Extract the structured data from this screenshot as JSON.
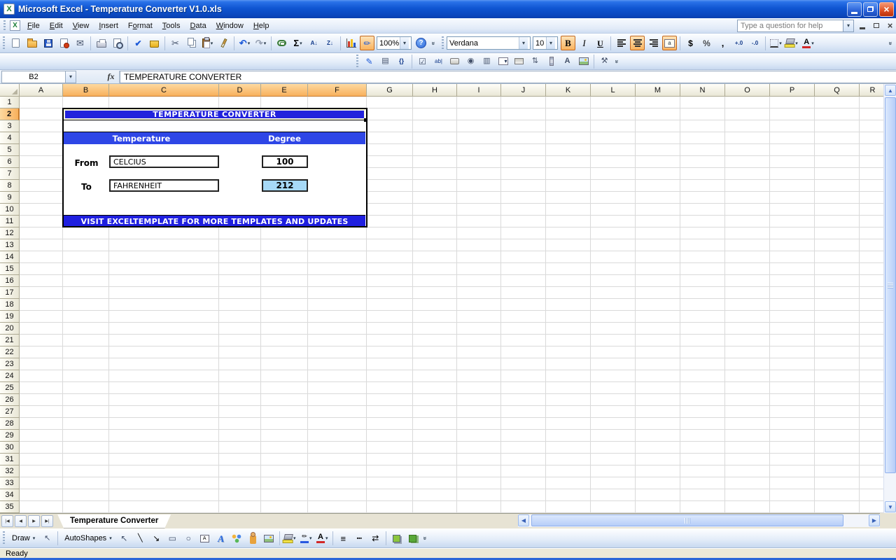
{
  "icons": {
    "dropdown": "▾",
    "excel_logo": "X",
    "fx": "fx",
    "close": "×",
    "chevron": "»",
    "scroll_up": "▲",
    "scroll_down": "▼",
    "scroll_left": "◀",
    "scroll_right": "▶"
  },
  "colors": {
    "xp_title_blue": "#0f55d2",
    "form_title_blue": "#2222dd",
    "form_band_blue": "#2e46e6",
    "form_footer_blue": "#1f1fe0",
    "result_cell_fill": "#a6d9f7",
    "selected_header_orange": "#f8b05c"
  },
  "window": {
    "title": "Microsoft Excel - Temperature Converter V1.0.xls"
  },
  "menu_bar": {
    "items": [
      {
        "label": "File",
        "accel": 0
      },
      {
        "label": "Edit",
        "accel": 0
      },
      {
        "label": "View",
        "accel": 0
      },
      {
        "label": "Insert",
        "accel": 0
      },
      {
        "label": "Format",
        "accel": 1
      },
      {
        "label": "Tools",
        "accel": 0
      },
      {
        "label": "Data",
        "accel": 0
      },
      {
        "label": "Window",
        "accel": 0
      },
      {
        "label": "Help",
        "accel": 0
      }
    ],
    "help_placeholder": "Type a question for help"
  },
  "standard_toolbar": {
    "zoom_value": "100%",
    "items": [
      {
        "name": "new",
        "cls": "i-page"
      },
      {
        "name": "open",
        "cls": "i-folder"
      },
      {
        "name": "save",
        "cls": "i-floppy"
      },
      {
        "name": "permission",
        "cls": "i-page i-perm"
      },
      {
        "name": "email",
        "glyph": "✉",
        "gcls": "c-slate fs13"
      },
      {
        "type": "sep"
      },
      {
        "name": "print",
        "cls": "i-printer"
      },
      {
        "name": "print-preview",
        "cls": "i-preview"
      },
      {
        "type": "sep"
      },
      {
        "name": "spelling",
        "glyph": "✔",
        "gcls": "c-blue fs12 bold"
      },
      {
        "name": "research",
        "cls": "i-book"
      },
      {
        "type": "sep"
      },
      {
        "name": "cut",
        "glyph": "✂",
        "gcls": "c-slate fs13"
      },
      {
        "name": "copy",
        "cls": "i-copy"
      },
      {
        "name": "paste",
        "cls": "i-paste",
        "dd": true
      },
      {
        "name": "format-painter",
        "cls": "i-brush"
      },
      {
        "type": "sep"
      },
      {
        "name": "undo",
        "glyph": "↶",
        "gcls": "c-blue fs13 bold",
        "dd": true
      },
      {
        "name": "redo",
        "glyph": "↷",
        "gcls": "c-gray fs13 bold",
        "dd": true
      },
      {
        "type": "sep"
      },
      {
        "name": "insert-hyperlink",
        "cls": "i-link"
      },
      {
        "name": "autosum",
        "glyph": "Σ",
        "gcls": "fs13 bold",
        "dd": true
      },
      {
        "name": "sort-ascending",
        "glyph": "A↓",
        "gcls": "fs8 bold c-navy"
      },
      {
        "name": "sort-descending",
        "glyph": "Z↓",
        "gcls": "fs8 bold c-navy"
      },
      {
        "type": "sep"
      },
      {
        "name": "chart-wizard",
        "cls": "i-chart"
      },
      {
        "name": "drawing",
        "glyph": "✏",
        "gcls": "c-blue fs12",
        "active": true
      }
    ]
  },
  "formatting_toolbar": {
    "font": "Verdana",
    "size": "10",
    "items": [
      {
        "name": "bold",
        "glyph": "B",
        "gcls": "serif bold fs13",
        "active": true
      },
      {
        "name": "italic",
        "glyph": "I",
        "gcls": "serif ital fs13"
      },
      {
        "name": "underline",
        "glyph": "U",
        "gcls": "serif bold underline fs12"
      },
      {
        "type": "sep"
      },
      {
        "name": "align-left",
        "cls": "i-al"
      },
      {
        "name": "align-center",
        "cls": "i-ac",
        "active": true
      },
      {
        "name": "align-right",
        "cls": "i-ar"
      },
      {
        "name": "merge-and-center",
        "cls": "i-merge",
        "glyph": "a",
        "gcls": "fs8",
        "active": true
      },
      {
        "type": "sep"
      },
      {
        "name": "currency",
        "glyph": "$",
        "gcls": "bold fs12"
      },
      {
        "name": "percent",
        "glyph": "%",
        "gcls": "fs12"
      },
      {
        "name": "comma",
        "glyph": ",",
        "gcls": "bold fs13"
      },
      {
        "name": "increase-decimal",
        "glyph": "+.0",
        "gcls": "fs8 bold c-navy"
      },
      {
        "name": "decrease-decimal",
        "glyph": "-.0",
        "gcls": "fs8 bold c-navy"
      },
      {
        "type": "sep"
      },
      {
        "name": "borders",
        "cls": "i-borders",
        "dd": true
      },
      {
        "name": "fill-color",
        "cls": "i-fill",
        "dd": true
      },
      {
        "name": "font-color",
        "cls": "i-fontcolor",
        "glyph": "A",
        "gcls": "bold fs11",
        "dd": true
      }
    ]
  },
  "control_toolbox": {
    "items": [
      {
        "name": "design-mode",
        "glyph": "✎",
        "gcls": "c-blue fs12"
      },
      {
        "name": "properties",
        "glyph": "▤",
        "gcls": "c-slate fs11"
      },
      {
        "name": "view-code",
        "glyph": "{}",
        "gcls": "fs9 bold c-navy"
      },
      {
        "type": "sep"
      },
      {
        "name": "check-box",
        "glyph": "☑",
        "gcls": "fs12 c-slate"
      },
      {
        "name": "text-box",
        "glyph": "ab|",
        "gcls": "fs8 c-navy"
      },
      {
        "name": "command-button",
        "cls": "i-cmdbtn"
      },
      {
        "name": "option-button",
        "glyph": "◉",
        "gcls": "fs11 c-slate"
      },
      {
        "name": "list-box",
        "glyph": "▥",
        "gcls": "fs11 c-slate"
      },
      {
        "name": "combo-box",
        "cls": "i-combo",
        "glyph": "▾",
        "gcls": "fs8"
      },
      {
        "name": "toggle-button",
        "cls": "i-toggle"
      },
      {
        "name": "spin-button",
        "glyph": "⇅",
        "gcls": "fs11 c-slate"
      },
      {
        "name": "scroll-bar",
        "cls": "i-scroll"
      },
      {
        "name": "label",
        "glyph": "A",
        "gcls": "bold fs11 c-slate"
      },
      {
        "name": "image",
        "cls": "i-pic"
      },
      {
        "type": "sep"
      },
      {
        "name": "more-controls",
        "glyph": "⚒",
        "gcls": "fs11 c-slate"
      }
    ]
  },
  "formula_bar": {
    "name_box": "B2",
    "formula": "TEMPERATURE CONVERTER"
  },
  "grid": {
    "columns": [
      {
        "label": "A",
        "width": 62,
        "selected": false
      },
      {
        "label": "B",
        "width": 66,
        "selected": true
      },
      {
        "label": "C",
        "width": 157,
        "selected": true
      },
      {
        "label": "D",
        "width": 60,
        "selected": true
      },
      {
        "label": "E",
        "width": 67,
        "selected": true
      },
      {
        "label": "F",
        "width": 84,
        "selected": true
      },
      {
        "label": "G",
        "width": 66,
        "selected": false
      },
      {
        "label": "H",
        "width": 63,
        "selected": false
      },
      {
        "label": "I",
        "width": 63,
        "selected": false
      },
      {
        "label": "J",
        "width": 64,
        "selected": false
      },
      {
        "label": "K",
        "width": 64,
        "selected": false
      },
      {
        "label": "L",
        "width": 64,
        "selected": false
      },
      {
        "label": "M",
        "width": 64,
        "selected": false
      },
      {
        "label": "N",
        "width": 64,
        "selected": false
      },
      {
        "label": "O",
        "width": 64,
        "selected": false
      },
      {
        "label": "P",
        "width": 64,
        "selected": false
      },
      {
        "label": "Q",
        "width": 64,
        "selected": false
      },
      {
        "label": "R",
        "width": 38,
        "selected": false
      }
    ],
    "row_labels": [
      "1",
      "2",
      "3",
      "4",
      "5",
      "6",
      "7",
      "8",
      "9",
      "10",
      "11",
      "12",
      "13",
      "14",
      "15",
      "16",
      "17",
      "18",
      "19",
      "20",
      "21",
      "22",
      "23",
      "24",
      "25",
      "26",
      "27",
      "28",
      "29",
      "30",
      "31",
      "32",
      "33",
      "34",
      "35"
    ],
    "selected_row": "2"
  },
  "form": {
    "title": "TEMPERATURE CONVERTER",
    "col_temperature": "Temperature",
    "col_degree": "Degree",
    "from_label": "From",
    "from_unit": "CELCIUS",
    "from_value": "100",
    "to_label": "To",
    "to_unit": "FAHRENHEIT",
    "to_value": "212",
    "footer": "VISIT EXCELTEMPLATE FOR MORE TEMPLATES AND UPDATES"
  },
  "sheet_tabs": {
    "active": "Temperature Converter",
    "nav": [
      {
        "name": "first-sheet",
        "glyph": "|◀"
      },
      {
        "name": "previous-sheet",
        "glyph": "◀"
      },
      {
        "name": "next-sheet",
        "glyph": "▶"
      },
      {
        "name": "last-sheet",
        "glyph": "▶|"
      }
    ]
  },
  "drawing_toolbar": {
    "draw_label": "Draw",
    "autoshapes_label": "AutoShapes",
    "items": [
      {
        "name": "select-objects",
        "glyph": "↖",
        "gcls": "fs12 c-slate"
      },
      {
        "name": "line",
        "glyph": "╲",
        "gcls": "fs11"
      },
      {
        "name": "arrow",
        "glyph": "↘",
        "gcls": "fs12"
      },
      {
        "name": "rectangle",
        "glyph": "▭",
        "gcls": "fs12 c-slate"
      },
      {
        "name": "oval",
        "glyph": "○",
        "gcls": "fs12 c-slate"
      },
      {
        "name": "insert-text-box",
        "cls": "i-tbx",
        "glyph": "A",
        "gcls": "fs7"
      },
      {
        "name": "insert-wordart",
        "glyph": "A",
        "gcls": "wordart fs13"
      },
      {
        "name": "insert-diagram",
        "cls": "i-diagram"
      },
      {
        "name": "insert-clip-art",
        "cls": "i-clipart"
      },
      {
        "name": "insert-picture",
        "cls": "i-pic"
      },
      {
        "type": "sep"
      },
      {
        "name": "draw-fill-color",
        "cls": "i-fill",
        "dd": true
      },
      {
        "name": "draw-line-color",
        "cls": "i-linecolor",
        "glyph": "✏",
        "gcls": "fs9",
        "dd": true
      },
      {
        "name": "draw-font-color",
        "cls": "i-fontcolor2",
        "glyph": "A",
        "gcls": "bold fs11",
        "dd": true
      },
      {
        "type": "sep"
      },
      {
        "name": "line-style",
        "glyph": "≡",
        "gcls": "fs13 bold"
      },
      {
        "name": "dash-style",
        "glyph": "┅",
        "gcls": "fs12"
      },
      {
        "name": "arrow-style",
        "glyph": "⇄",
        "gcls": "fs12"
      },
      {
        "type": "sep"
      },
      {
        "name": "shadow-style",
        "cls": "i-shadow"
      },
      {
        "name": "3d-style",
        "cls": "i-3d"
      }
    ]
  },
  "status_bar": {
    "text": "Ready"
  }
}
